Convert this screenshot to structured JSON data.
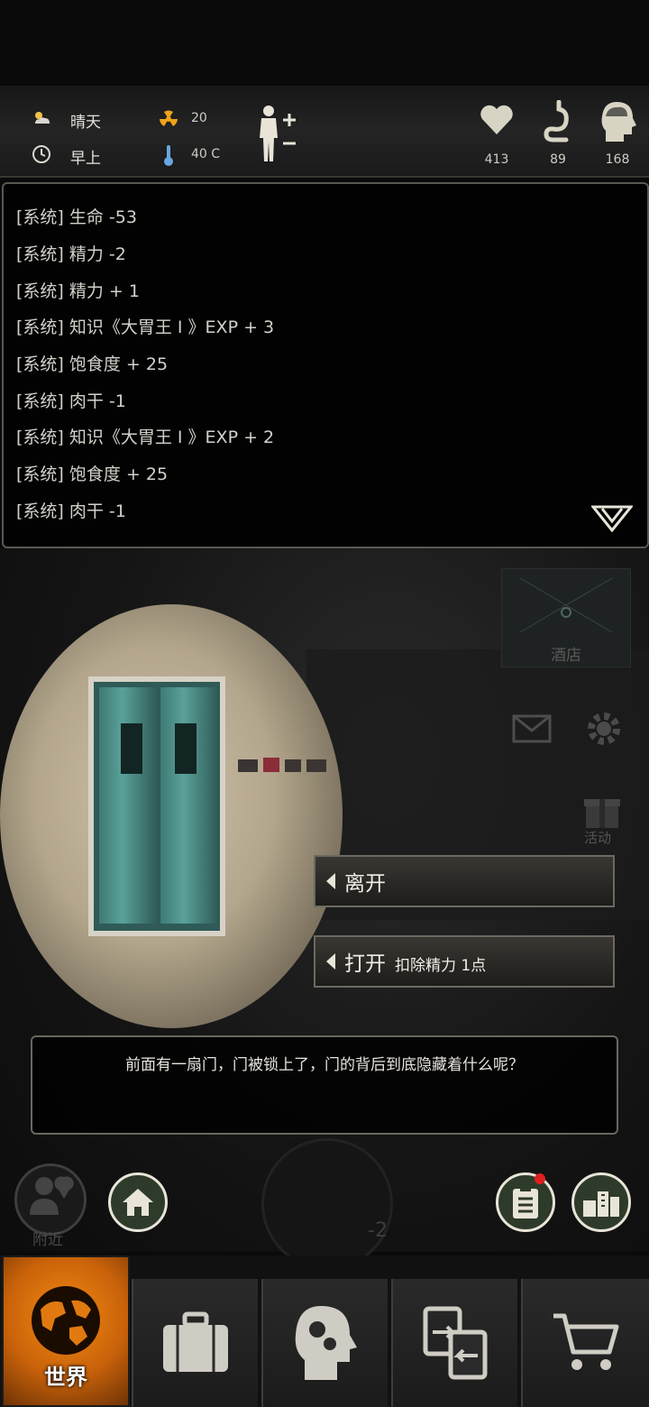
{
  "status": {
    "weather": "晴天",
    "time_of_day": "早上",
    "radiation": "20",
    "temperature": "40 C",
    "health": "413",
    "hunger": "89",
    "mind": "168"
  },
  "log": [
    "[系统] 生命 -53",
    "[系统] 精力 -2",
    "[系统] 精力 + 1",
    "[系统] 知识《大胃王 I 》EXP + 3",
    "[系统] 饱食度 + 25",
    "[系统] 肉干 -1",
    "[系统] 知识《大胃王 I 》EXP + 2",
    "[系统] 饱食度 + 25",
    "[系统] 肉干 -1"
  ],
  "scene": {
    "hotel_label": "酒店",
    "activity_label": "活动",
    "nearby_label": "附近",
    "gauge_value": "-2"
  },
  "choices": [
    {
      "label": "离开",
      "sub": ""
    },
    {
      "label": "打开",
      "sub": "扣除精力 1点"
    }
  ],
  "description": "前面有一扇门，门被锁上了，门的背后到底隐藏着什么呢？",
  "nav": {
    "world_label": "世界"
  },
  "colors": {
    "accent_orange": "#f28a12",
    "panel_border": "#5a5852"
  }
}
